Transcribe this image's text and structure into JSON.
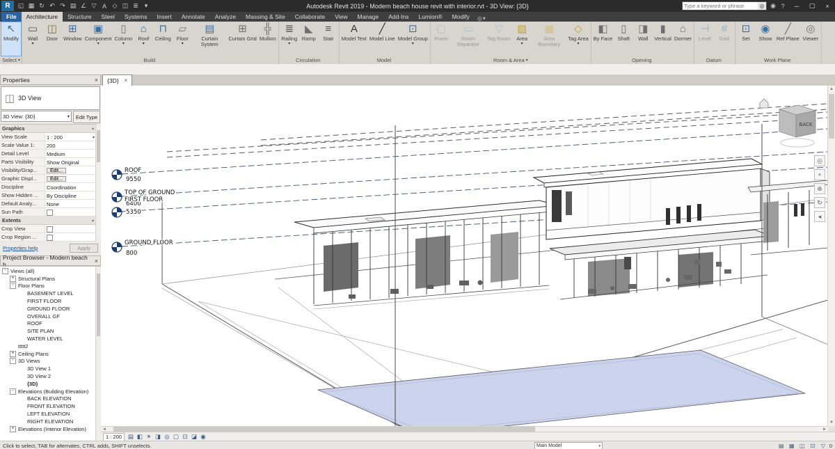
{
  "title_bar": {
    "logo": "R",
    "quick_access": [
      {
        "name": "open-icon",
        "glyph": "◱"
      },
      {
        "name": "save-icon",
        "glyph": "▦"
      },
      {
        "name": "sync-icon",
        "glyph": "↻"
      },
      {
        "name": "undo-icon",
        "glyph": "↶"
      },
      {
        "name": "redo-icon",
        "glyph": "↷"
      },
      {
        "name": "print-icon",
        "glyph": "▤"
      },
      {
        "name": "measure-icon",
        "glyph": "∠"
      },
      {
        "name": "tag-icon",
        "glyph": "▽"
      },
      {
        "name": "text-icon",
        "glyph": "A"
      },
      {
        "name": "3d-view-icon",
        "glyph": "◇"
      },
      {
        "name": "section-icon",
        "glyph": "◫"
      },
      {
        "name": "thin-lines-icon",
        "glyph": "≣"
      },
      {
        "name": "qat-dropdown-icon",
        "glyph": "▾"
      }
    ],
    "title": "Autodesk Revit 2019 - Modern beach house revit with interior.rvt - 3D View: {3D}",
    "search": {
      "placeholder": "Type a keyword or phrase",
      "go_icon": "◎"
    },
    "infocenter_icons": [
      {
        "name": "signin-icon",
        "glyph": "◉"
      },
      {
        "name": "help-icon",
        "glyph": "?"
      }
    ],
    "window_controls": [
      {
        "name": "minimize-button",
        "glyph": "─"
      },
      {
        "name": "restore-button",
        "glyph": "▢"
      },
      {
        "name": "close-button",
        "glyph": "×"
      }
    ]
  },
  "ribbon_tabs": {
    "tabs": [
      {
        "label": "File",
        "state": "file"
      },
      {
        "label": "Architecture",
        "state": "active"
      },
      {
        "label": "Structure"
      },
      {
        "label": "Steel"
      },
      {
        "label": "Systems"
      },
      {
        "label": "Insert"
      },
      {
        "label": "Annotate"
      },
      {
        "label": "Analyze"
      },
      {
        "label": "Massing & Site"
      },
      {
        "label": "Collaborate"
      },
      {
        "label": "View"
      },
      {
        "label": "Manage"
      },
      {
        "label": "Add-Ins"
      },
      {
        "label": "Lumion®"
      },
      {
        "label": "Modify"
      }
    ],
    "modify_circle": "◎",
    "modify_caret": "▾"
  },
  "ribbon": {
    "groups": [
      {
        "name": "Select",
        "drop": "▾",
        "buttons": [
          {
            "label": "Modify",
            "icon": "↖",
            "icon_color": "#44688e",
            "state": "active"
          }
        ]
      },
      {
        "name": "Build",
        "drop": "",
        "buttons": [
          {
            "label": "Wall",
            "icon": "▭",
            "icon_color": "#5a5a5a",
            "arrow": "▾"
          },
          {
            "label": "Door",
            "icon": "◫",
            "icon_color": "#8a6d3b"
          },
          {
            "label": "Window",
            "icon": "⊞",
            "icon_color": "#3a6ea5"
          },
          {
            "label": "Component",
            "icon": "▣",
            "icon_color": "#3a6ea5",
            "arrow": "▾"
          },
          {
            "label": "Column",
            "icon": "▯",
            "icon_color": "#6f6f6f",
            "arrow": "▾"
          },
          {
            "label": "Roof",
            "icon": "⌂",
            "icon_color": "#3a6ea5",
            "arrow": "▾"
          },
          {
            "label": "Ceiling",
            "icon": "⊓",
            "icon_color": "#3a6ea5"
          },
          {
            "label": "Floor",
            "icon": "▱",
            "icon_color": "#6f6f6f",
            "arrow": "▾"
          },
          {
            "label": "Curtain System",
            "icon": "▤",
            "icon_color": "#3a6ea5"
          },
          {
            "label": "Curtain Grid",
            "icon": "⊞",
            "icon_color": "#6f6f6f"
          },
          {
            "label": "Mullion",
            "icon": "╬",
            "icon_color": "#6f6f6f"
          }
        ]
      },
      {
        "name": "Circulation",
        "drop": "",
        "buttons": [
          {
            "label": "Railing",
            "icon": "≣",
            "icon_color": "#555555",
            "arrow": "▾"
          },
          {
            "label": "Ramp",
            "icon": "◣",
            "icon_color": "#6f6f6f"
          },
          {
            "label": "Stair",
            "icon": "≡",
            "icon_color": "#555555"
          }
        ]
      },
      {
        "name": "Model",
        "drop": "",
        "buttons": [
          {
            "label": "Model Text",
            "icon": "A",
            "icon_color": "#333333"
          },
          {
            "label": "Model Line",
            "icon": "╱",
            "icon_color": "#333333"
          },
          {
            "label": "Model Group",
            "icon": "⊡",
            "icon_color": "#3a6ea5",
            "arrow": "▾"
          }
        ]
      },
      {
        "name": "Room & Area",
        "drop": "▾",
        "buttons": [
          {
            "label": "Room",
            "icon": "▢",
            "icon_color": "#6fa0c8",
            "state": "disabled"
          },
          {
            "label": "Room Separator",
            "icon": "▭",
            "icon_color": "#6fa0c8",
            "state": "disabled"
          },
          {
            "label": "Tag Room",
            "icon": "▽",
            "icon_color": "#6fa0c8",
            "state": "disabled"
          },
          {
            "label": "Area",
            "icon": "▨",
            "icon_color": "#c9a227",
            "arrow": "▾"
          },
          {
            "label": "Area Boundary",
            "icon": "▦",
            "icon_color": "#c9a227",
            "state": "disabled"
          },
          {
            "label": "Tag Area",
            "icon": "◇",
            "icon_color": "#c9a227",
            "arrow": "▾"
          }
        ]
      },
      {
        "name": "Opening",
        "drop": "",
        "buttons": [
          {
            "label": "By Face",
            "icon": "◧",
            "icon_color": "#6f6f6f"
          },
          {
            "label": "Shaft",
            "icon": "▯",
            "icon_color": "#6f6f6f"
          },
          {
            "label": "Wall",
            "icon": "◨",
            "icon_color": "#6f6f6f"
          },
          {
            "label": "Vertical",
            "icon": "▮",
            "icon_color": "#6f6f6f"
          },
          {
            "label": "Dormer",
            "icon": "⌂",
            "icon_color": "#6f6f6f"
          }
        ]
      },
      {
        "name": "Datum",
        "drop": "",
        "buttons": [
          {
            "label": "Level",
            "icon": "⊣",
            "icon_color": "#2e75b6",
            "state": "disabled"
          },
          {
            "label": "Grid",
            "icon": "#",
            "icon_color": "#2e75b6",
            "state": "disabled"
          }
        ]
      },
      {
        "name": "Work Plane",
        "drop": "",
        "buttons": [
          {
            "label": "Set",
            "icon": "⊡",
            "icon_color": "#3a6ea5"
          },
          {
            "label": "Show",
            "icon": "◉",
            "icon_color": "#3a6ea5"
          },
          {
            "label": "Ref Plane",
            "icon": "╱",
            "icon_color": "#6f6f6f"
          },
          {
            "label": "Viewer",
            "icon": "◎",
            "icon_color": "#6f6f6f"
          }
        ]
      }
    ]
  },
  "view_tab": {
    "label": "{3D}",
    "close_icon": "×"
  },
  "properties": {
    "title": "Properties",
    "close_icon": "×",
    "type_selector": {
      "icon": "◫",
      "label": "3D View"
    },
    "instance_label": "3D View: {3D}",
    "instance_caret": "▾",
    "edit_type": "Edit Type",
    "graphics_header": "Graphics",
    "section_caret": "▴",
    "graphics_rows": [
      {
        "label": "View Scale",
        "value": "1 : 200",
        "type": "dropdown"
      },
      {
        "label": "Scale Value 1:",
        "value": "200",
        "type": "text"
      },
      {
        "label": "Detail Level",
        "value": "Medium",
        "type": "text"
      },
      {
        "label": "Parts Visibility",
        "value": "Show Original",
        "type": "text"
      },
      {
        "label": "Visibility/Grap...",
        "value": "Edit...",
        "type": "button"
      },
      {
        "label": "Graphic Displ...",
        "value": "Edit...",
        "type": "button"
      },
      {
        "label": "Discipline",
        "value": "Coordination",
        "type": "text"
      },
      {
        "label": "Show Hidden ...",
        "value": "By Discipline",
        "type": "text"
      },
      {
        "label": "Default Analy...",
        "value": "None",
        "type": "text"
      },
      {
        "label": "Sun Path",
        "value": "",
        "type": "check"
      }
    ],
    "extents_header": "Extents",
    "extents_rows": [
      {
        "label": "Crop View",
        "value": "",
        "type": "check"
      },
      {
        "label": "Crop Region ...",
        "value": "",
        "type": "check"
      }
    ],
    "help_link": "Properties help",
    "apply_label": "Apply"
  },
  "project_browser": {
    "title": "Project Browser - Modern beach h...",
    "close_icon": "×",
    "items": [
      {
        "depth": 0,
        "glyph": "-",
        "label": "Views (all)"
      },
      {
        "depth": 1,
        "glyph": "+",
        "label": "Structural Plans"
      },
      {
        "depth": 1,
        "glyph": "-",
        "label": "Floor Plans"
      },
      {
        "depth": 2,
        "glyph": "",
        "label": "BASEMENT LEVEL"
      },
      {
        "depth": 2,
        "glyph": "",
        "label": "FIRST FLOOR"
      },
      {
        "depth": 2,
        "glyph": "",
        "label": "GROUND FLOOR"
      },
      {
        "depth": 2,
        "glyph": "",
        "label": "OVERALL GF"
      },
      {
        "depth": 2,
        "glyph": "",
        "label": "ROOF"
      },
      {
        "depth": 2,
        "glyph": "",
        "label": "SITE PLAN"
      },
      {
        "depth": 2,
        "glyph": "",
        "label": "WATER LEVEL"
      },
      {
        "depth": 1,
        "glyph": "",
        "label": "ttttt2"
      },
      {
        "depth": 1,
        "glyph": "+",
        "label": "Ceiling Plans"
      },
      {
        "depth": 1,
        "glyph": "-",
        "label": "3D Views"
      },
      {
        "depth": 2,
        "glyph": "",
        "label": "3D View 1"
      },
      {
        "depth": 2,
        "glyph": "",
        "label": "3D View 2"
      },
      {
        "depth": 2,
        "glyph": "",
        "label": "{3D}",
        "bold": true
      },
      {
        "depth": 1,
        "glyph": "-",
        "label": "Elevations (Building Elevation)"
      },
      {
        "depth": 2,
        "glyph": "",
        "label": "BACK ELEVATION"
      },
      {
        "depth": 2,
        "glyph": "",
        "label": "FRONT ELEVATION"
      },
      {
        "depth": 2,
        "glyph": "",
        "label": "LEFT ELEVATION"
      },
      {
        "depth": 2,
        "glyph": "",
        "label": "RIGHT ELEVATION"
      },
      {
        "depth": 1,
        "glyph": "+",
        "label": "Elevations (Interior Elevation)"
      }
    ]
  },
  "viewport": {
    "levels": [
      {
        "name": "ROOF",
        "elevation": "9550"
      },
      {
        "name": "TOP OF GROUND",
        "elevation": "6400"
      },
      {
        "name": "FIRST FLOOR",
        "elevation": "5350"
      },
      {
        "name": "GROUND FLOOR",
        "elevation": "800"
      }
    ],
    "viewcube": {
      "face": "BACK"
    },
    "navigation_icons": [
      {
        "name": "steering-wheel-icon",
        "glyph": "◎"
      },
      {
        "name": "pan-icon",
        "glyph": "+"
      },
      {
        "name": "zoom-icon",
        "glyph": "⊕"
      },
      {
        "name": "orbit-icon",
        "glyph": "↻"
      },
      {
        "name": "rewind-icon",
        "glyph": "◂"
      }
    ],
    "view_control_bar": {
      "scale": "1 : 200",
      "icons": [
        {
          "name": "detail-level-icon",
          "glyph": "▤"
        },
        {
          "name": "visual-style-icon",
          "glyph": "◧"
        },
        {
          "name": "sun-path-icon",
          "glyph": "☀"
        },
        {
          "name": "shadows-icon",
          "glyph": "◨"
        },
        {
          "name": "photo-render-icon",
          "glyph": "◎"
        },
        {
          "name": "crop-view-icon",
          "glyph": "▢"
        },
        {
          "name": "crop-region-icon",
          "glyph": "⊡"
        },
        {
          "name": "temporary-hide-icon",
          "glyph": "◪"
        },
        {
          "name": "reveal-hidden-icon",
          "glyph": "◉"
        }
      ]
    }
  },
  "status_bar": {
    "hint": "Click to select, TAB for alternates, CTRL adds, SHIFT unselects.",
    "main_model": "Main Model",
    "dropdown_icon": "▾",
    "right_icons": [
      {
        "name": "worksharing-display-icon",
        "glyph": "▤"
      },
      {
        "name": "design-options-icon",
        "glyph": "▦"
      },
      {
        "name": "exclude-options-icon",
        "glyph": "◫"
      },
      {
        "name": "press-drag-icon",
        "glyph": "⊡"
      },
      {
        "name": "filter-icon",
        "glyph": "▽"
      }
    ],
    "filter_count": "0"
  }
}
